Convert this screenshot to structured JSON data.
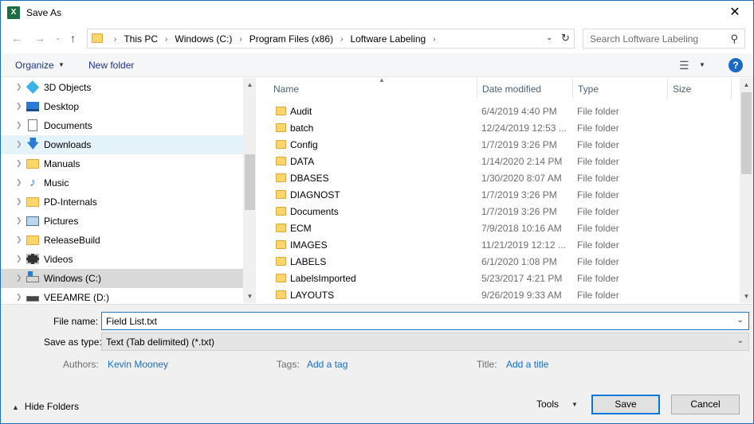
{
  "window": {
    "title": "Save As",
    "app_icon": "X",
    "close_glyph": "✕"
  },
  "address": {
    "crumbs": [
      "This PC",
      "Windows (C:)",
      "Program Files (x86)",
      "Loftware Labeling"
    ],
    "separator": "›"
  },
  "search": {
    "placeholder": "Search Loftware Labeling"
  },
  "toolbar": {
    "organize": "Organize",
    "new_folder": "New folder",
    "help": "?"
  },
  "nav_items": [
    {
      "label": "3D Objects",
      "icon": "cube-icon"
    },
    {
      "label": "Desktop",
      "icon": "desktop-icon"
    },
    {
      "label": "Documents",
      "icon": "documents-icon"
    },
    {
      "label": "Downloads",
      "icon": "download-arrow-icon"
    },
    {
      "label": "Manuals",
      "icon": "folder-icon"
    },
    {
      "label": "Music",
      "icon": "music-note-icon"
    },
    {
      "label": "PD-Internals",
      "icon": "folder-icon"
    },
    {
      "label": "Pictures",
      "icon": "pictures-icon"
    },
    {
      "label": "ReleaseBuild",
      "icon": "folder-icon"
    },
    {
      "label": "Videos",
      "icon": "film-icon"
    },
    {
      "label": "Windows (C:)",
      "icon": "windows-drive-icon"
    },
    {
      "label": "VEEAMRE (D:)",
      "icon": "dvd-drive-icon"
    }
  ],
  "columns": [
    "Name",
    "Date modified",
    "Type",
    "Size"
  ],
  "files": [
    {
      "name": "Audit",
      "date": "6/4/2019 4:40 PM",
      "type": "File folder"
    },
    {
      "name": "batch",
      "date": "12/24/2019 12:53 ...",
      "type": "File folder"
    },
    {
      "name": "Config",
      "date": "1/7/2019 3:26 PM",
      "type": "File folder"
    },
    {
      "name": "DATA",
      "date": "1/14/2020 2:14 PM",
      "type": "File folder"
    },
    {
      "name": "DBASES",
      "date": "1/30/2020 8:07 AM",
      "type": "File folder"
    },
    {
      "name": "DIAGNOST",
      "date": "1/7/2019 3:26 PM",
      "type": "File folder"
    },
    {
      "name": "Documents",
      "date": "1/7/2019 3:26 PM",
      "type": "File folder"
    },
    {
      "name": "ECM",
      "date": "7/9/2018 10:16 AM",
      "type": "File folder"
    },
    {
      "name": "IMAGES",
      "date": "11/21/2019 12:12 ...",
      "type": "File folder"
    },
    {
      "name": "LABELS",
      "date": "6/1/2020 1:08 PM",
      "type": "File folder"
    },
    {
      "name": "LabelsImported",
      "date": "5/23/2017 4:21 PM",
      "type": "File folder"
    },
    {
      "name": "LAYOUTS",
      "date": "9/26/2019 9:33 AM",
      "type": "File folder"
    }
  ],
  "form": {
    "file_name_label": "File name:",
    "file_name_value": "Field List.txt",
    "save_type_label": "Save as type:",
    "save_type_value": "Text (Tab delimited) (*.txt)",
    "authors_label": "Authors:",
    "authors_value": "Kevin Mooney",
    "tags_label": "Tags:",
    "tags_value": "Add a tag",
    "title_label": "Title:",
    "title_value": "Add a title",
    "hide_folders": "Hide Folders",
    "tools": "Tools",
    "save": "Save",
    "cancel": "Cancel"
  },
  "colors": {
    "accent": "#0078d7",
    "link": "#1a6dbd",
    "folder": "#fcd56b",
    "selected_nav": "#e5f3fb"
  }
}
